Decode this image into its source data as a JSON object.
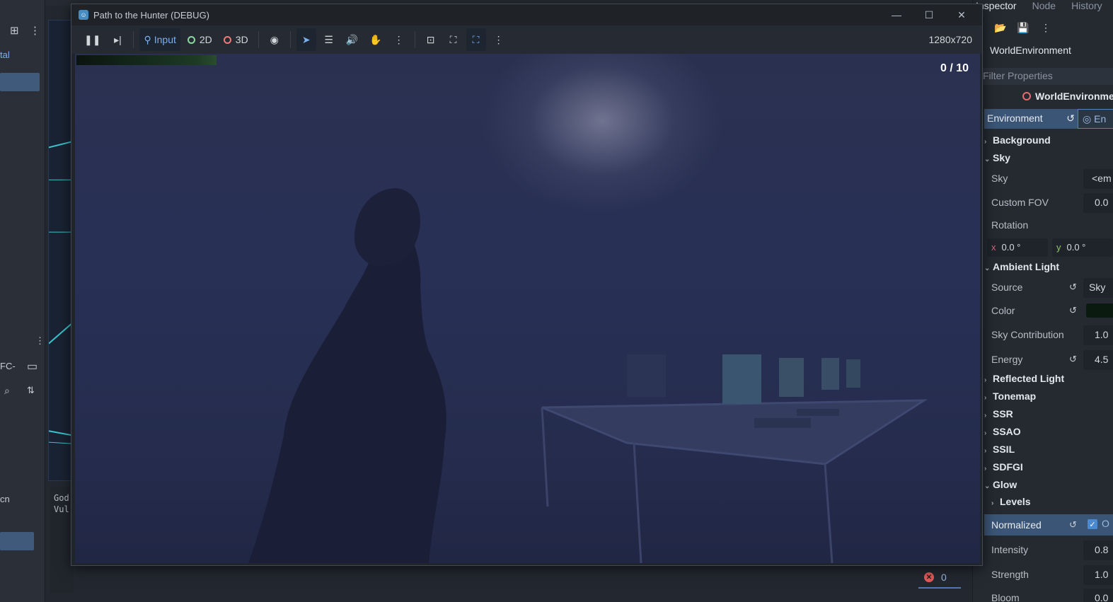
{
  "editor": {
    "left_panel": {
      "item_tal": "tal",
      "item_fc": "FC-",
      "item_cn": "cn"
    },
    "output_lines": [
      "God",
      "Vul"
    ],
    "error_count": "0"
  },
  "inspector": {
    "tabs": [
      "Inspector",
      "Node",
      "History"
    ],
    "node_name": "WorldEnvironment",
    "filter_placeholder": "Filter Properties",
    "resource_name": "WorldEnvironment",
    "environment_label": "Environment",
    "environment_value": "En",
    "sections": {
      "background": "Background",
      "sky": "Sky",
      "ambient_light": "Ambient Light",
      "reflected_light": "Reflected Light",
      "tonemap": "Tonemap",
      "ssr": "SSR",
      "ssao": "SSAO",
      "ssil": "SSIL",
      "sdfgi": "SDFGI",
      "glow": "Glow",
      "levels": "Levels"
    },
    "props": {
      "sky": {
        "label": "Sky",
        "value": "<em"
      },
      "custom_fov": {
        "label": "Custom FOV",
        "value": "0.0"
      },
      "rotation": {
        "label": "Rotation",
        "x": "0.0 °",
        "y": "0.0 °",
        "x_key": "x",
        "y_key": "y"
      },
      "source": {
        "label": "Source",
        "value": "Sky"
      },
      "color": {
        "label": "Color",
        "value_color": "#0b1a0e"
      },
      "sky_contribution": {
        "label": "Sky Contribution",
        "value": "1.0"
      },
      "energy": {
        "label": "Energy",
        "value": "4.5"
      },
      "normalized": {
        "label": "Normalized",
        "value": "O"
      },
      "intensity": {
        "label": "Intensity",
        "value": "0.8"
      },
      "strength": {
        "label": "Strength",
        "value": "1.0"
      },
      "bloom": {
        "label": "Bloom",
        "value": "0.0"
      }
    }
  },
  "game_window": {
    "title": "Path to the Hunter (DEBUG)",
    "toolbar": {
      "input_label": "Input",
      "two_d_label": "2D",
      "three_d_label": "3D"
    },
    "resolution": "1280x720",
    "hud_counter": "0 / 10",
    "icons": [
      "pause-icon",
      "step-icon",
      "eye-icon",
      "select-arrow-icon",
      "list-select-icon",
      "audio-icon",
      "camera-icon",
      "more-icon",
      "focus-icon",
      "fullscreen-icon",
      "embed-icon"
    ]
  },
  "colors": {
    "accent": "#4a8ad0",
    "input_blue": "#7ab0f0",
    "ring_2d": "#8cd9a0",
    "ring_3d": "#ef7a7a"
  }
}
